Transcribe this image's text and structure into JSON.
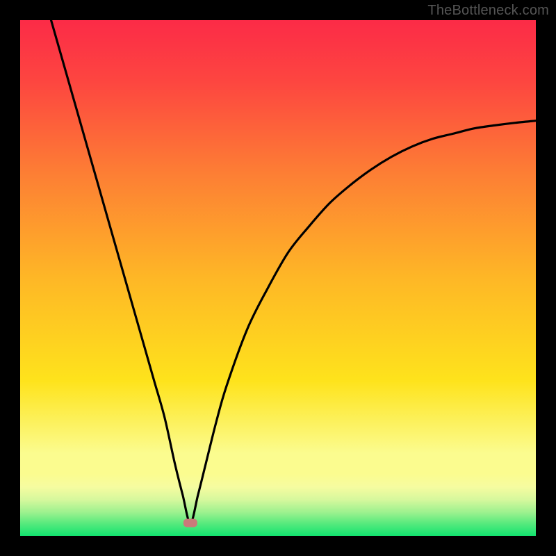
{
  "watermark": "TheBottleneck.com",
  "colors": {
    "gradient_top": "#fc2b47",
    "gradient_mid": "#fed420",
    "gradient_yellow_band": "#fbfc8f",
    "gradient_bottom": "#12e36f",
    "frame": "#000000",
    "curve": "#000000",
    "marker": "#c97a7a"
  },
  "chart_data": {
    "type": "line",
    "title": "",
    "xlabel": "",
    "ylabel": "",
    "xlim": [
      0,
      100
    ],
    "ylim": [
      0,
      100
    ],
    "grid": false,
    "legend": false,
    "annotations": [
      {
        "text": "TheBottleneck.com",
        "x": 100,
        "y": 100,
        "position": "outside-top-right"
      }
    ],
    "marker": {
      "x": 33,
      "y": 2.5,
      "shape": "rounded-rect"
    },
    "series": [
      {
        "name": "bottleneck-curve",
        "x": [
          6,
          8,
          10,
          12,
          14,
          16,
          18,
          20,
          22,
          24,
          26,
          28,
          30,
          31.5,
          33,
          34.5,
          36,
          38,
          40,
          44,
          48,
          52,
          56,
          60,
          64,
          68,
          72,
          76,
          80,
          84,
          88,
          92,
          96,
          100
        ],
        "y": [
          100,
          93,
          86,
          79,
          72,
          65,
          58,
          51,
          44,
          37,
          30,
          23,
          14,
          8,
          2.5,
          8,
          14,
          22,
          29,
          40,
          48,
          55,
          60,
          64.5,
          68,
          71,
          73.5,
          75.5,
          77,
          78,
          79,
          79.6,
          80.1,
          80.5
        ]
      }
    ]
  }
}
